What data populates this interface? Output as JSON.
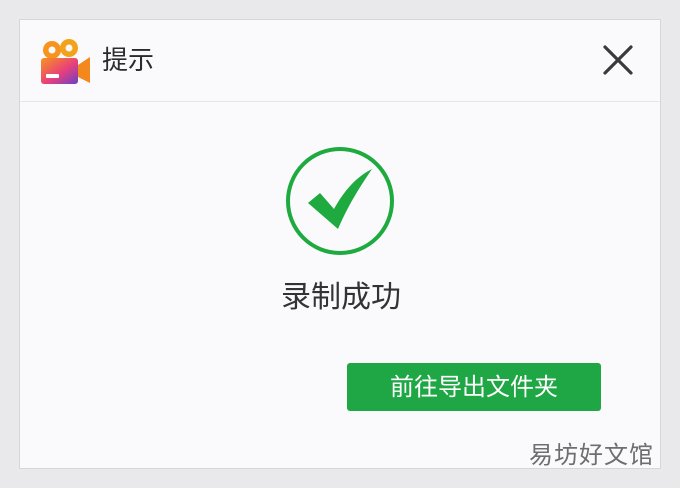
{
  "dialog": {
    "title": "提示",
    "app_icon": "video-camera-icon",
    "close_icon": "close-icon",
    "success_icon": "check-circle-icon",
    "message": "录制成功",
    "open_folder_label": "前往导出文件夹"
  },
  "watermark": "易坊好文馆",
  "colors": {
    "accent_green": "#20a745",
    "check_green": "#1faa3f",
    "icon_orange": "#f7941d",
    "icon_purple": "#6a3fc8",
    "icon_pink": "#e8407a"
  }
}
